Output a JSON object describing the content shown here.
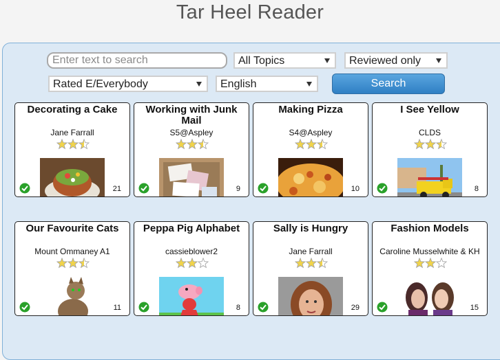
{
  "header": {
    "title": "Tar Heel Reader"
  },
  "search": {
    "placeholder": "Enter text to search",
    "topic": "All Topics",
    "review": "Reviewed only",
    "rating": "Rated E/Everybody",
    "language": "English",
    "button_label": "Search"
  },
  "colors": {
    "accent": "#3a89cf",
    "panel": "#dce9f5",
    "check": "#2aa12a",
    "star": "#f1d44a"
  },
  "books": [
    {
      "title": "Decorating a Cake",
      "author": "Jane Farrall",
      "rating": 2.5,
      "pages": "21",
      "reviewed": true,
      "thumb": "cake"
    },
    {
      "title": "Working with Junk Mail",
      "author": "S5@Aspley",
      "rating": 2.5,
      "pages": "9",
      "reviewed": true,
      "thumb": "junk-mail"
    },
    {
      "title": "Making Pizza",
      "author": "S4@Aspley",
      "rating": 2.5,
      "pages": "10",
      "reviewed": true,
      "thumb": "pizza"
    },
    {
      "title": "I See Yellow",
      "author": "CLDS",
      "rating": 2.5,
      "pages": "8",
      "reviewed": true,
      "thumb": "fire-truck"
    },
    {
      "title": "Our Favourite Cats",
      "author": "Mount Ommaney A1",
      "rating": 2.5,
      "pages": "11",
      "reviewed": true,
      "thumb": "cat"
    },
    {
      "title": "Peppa Pig Alphabet",
      "author": "cassieblower2",
      "rating": 2,
      "pages": "8",
      "reviewed": true,
      "thumb": "peppa-pig"
    },
    {
      "title": "Sally is Hungry",
      "author": "Jane Farrall",
      "rating": 2.5,
      "pages": "29",
      "reviewed": true,
      "thumb": "woman-portrait"
    },
    {
      "title": "Fashion Models",
      "author": "Caroline Musselwhite & KH",
      "rating": 2,
      "pages": "15",
      "reviewed": true,
      "thumb": "models"
    }
  ]
}
